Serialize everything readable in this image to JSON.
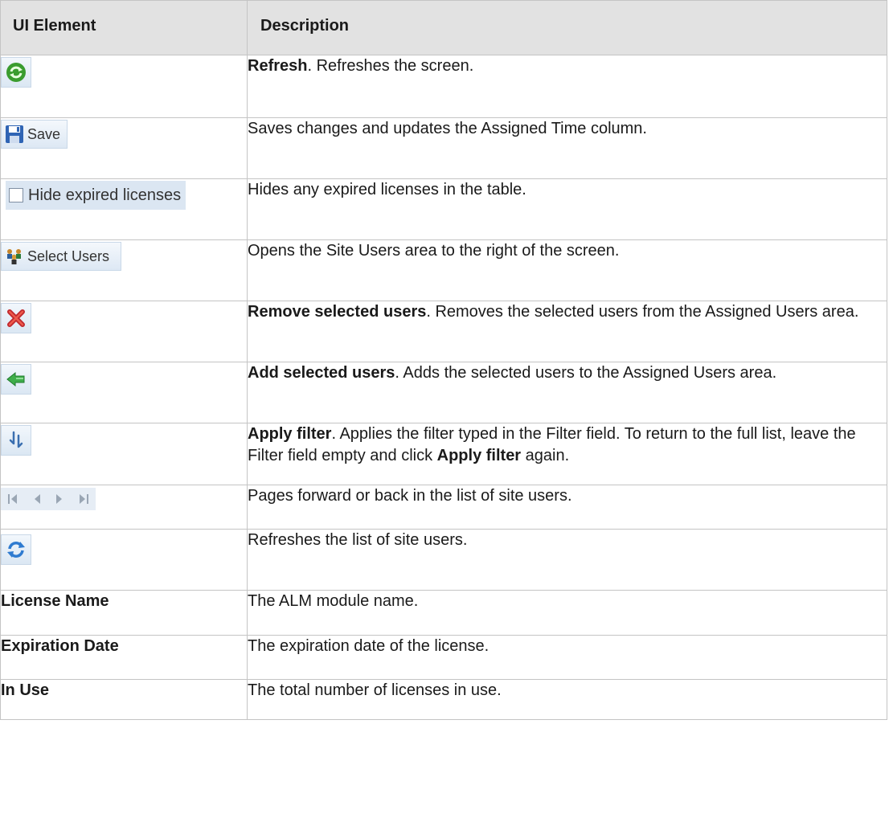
{
  "header": {
    "col1": "UI Element",
    "col2": "Description"
  },
  "rows": {
    "refresh": {
      "desc_bold": "Refresh",
      "desc_rest": ". Refreshes the screen."
    },
    "save": {
      "button_label": "Save",
      "desc": "Saves changes and updates the Assigned Time column."
    },
    "hide": {
      "checkbox_label": "Hide expired licenses",
      "desc": "Hides any expired licenses in the table."
    },
    "select": {
      "button_label": "Select Users",
      "desc": "Opens the Site Users area to the right of the screen."
    },
    "remove": {
      "desc_bold": "Remove selected users",
      "desc_rest": ". Removes the selected users from the Assigned Users area."
    },
    "add": {
      "desc_bold": "Add selected users",
      "desc_rest": ". Adds the selected users to the Assigned Users area."
    },
    "filter": {
      "desc_bold": "Apply filter",
      "desc_mid": ". Applies the filter typed in the Filter field. To return to the full list, leave the Filter field empty and click ",
      "desc_bold2": "Apply filter",
      "desc_end": " again."
    },
    "pager": {
      "desc": "Pages forward or back in the list of site users."
    },
    "site_refresh": {
      "desc": "Refreshes the list of site users."
    },
    "license_name": {
      "element": "License Name",
      "desc": "The ALM module name."
    },
    "expiration": {
      "element": "Expiration Date",
      "desc": "The expiration date of the license."
    },
    "in_use": {
      "element": "In Use",
      "desc": "The total number of licenses in use."
    }
  },
  "icons": {
    "refresh": "refresh-icon",
    "save": "floppy-disk-icon",
    "select_users": "users-group-icon",
    "remove": "red-x-icon",
    "add": "green-left-arrow-icon",
    "filter": "filter-arrow-icon",
    "pager": "pager-arrows-icon",
    "site_refresh": "blue-refresh-icon"
  },
  "colors": {
    "header_bg": "#e2e2e2",
    "border": "#c4c4c4",
    "button_bg": "#dbe7f3"
  }
}
